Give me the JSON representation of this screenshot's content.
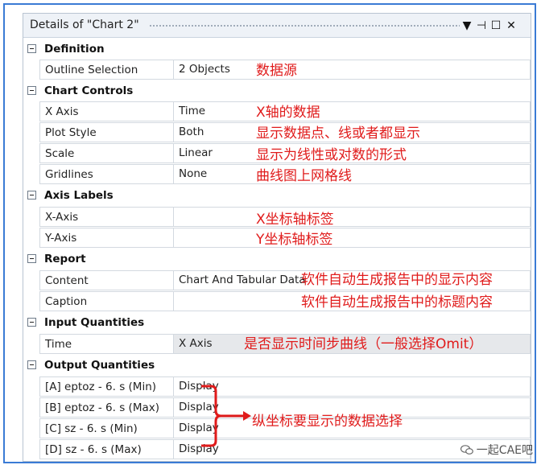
{
  "window": {
    "title": "Details of \"Chart 2\"",
    "icons": [
      "dropdown-icon",
      "pin-icon",
      "maximize-icon",
      "close-icon"
    ]
  },
  "sections": [
    {
      "label": "Definition",
      "rows": [
        {
          "name": "Outline Selection",
          "value": "2 Objects",
          "note": "数据源"
        }
      ]
    },
    {
      "label": "Chart Controls",
      "rows": [
        {
          "name": "X Axis",
          "value": "Time",
          "note": "X轴的数据"
        },
        {
          "name": "Plot Style",
          "value": "Both",
          "note": "显示数据点、线或者都显示"
        },
        {
          "name": "Scale",
          "value": "Linear",
          "note": "显示为线性或对数的形式"
        },
        {
          "name": "Gridlines",
          "value": "None",
          "note": "曲线图上网格线"
        }
      ]
    },
    {
      "label": "Axis Labels",
      "rows": [
        {
          "name": "X-Axis",
          "value": "",
          "note": "X坐标轴标签"
        },
        {
          "name": "Y-Axis",
          "value": "",
          "note": "Y坐标轴标签"
        }
      ]
    },
    {
      "label": "Report",
      "rows": [
        {
          "name": "Content",
          "value": "Chart And Tabular Data",
          "note": "软件自动生成报告中的显示内容"
        },
        {
          "name": "Caption",
          "value": "",
          "note": "软件自动生成报告中的标题内容"
        }
      ]
    },
    {
      "label": "Input Quantities",
      "rows": [
        {
          "name": "Time",
          "value": "X Axis",
          "note": "是否显示时间步曲线（一般选择Omit）"
        }
      ]
    },
    {
      "label": "Output Quantities",
      "rows": [
        {
          "name": "[A] eptoz - 6. s (Min)",
          "value": "Display"
        },
        {
          "name": "[B] eptoz - 6. s (Max)",
          "value": "Display"
        },
        {
          "name": "[C] sz - 6. s (Min)",
          "value": "Display"
        },
        {
          "name": "[D] sz - 6. s (Max)",
          "value": "Display"
        }
      ]
    }
  ],
  "output_note": "纵坐标要显示的数据选择",
  "watermark": "一起CAE吧",
  "colors": {
    "annotation": "#e01b1b",
    "frame": "#3a7bd5",
    "highlight_row": "#e6e8eb"
  }
}
